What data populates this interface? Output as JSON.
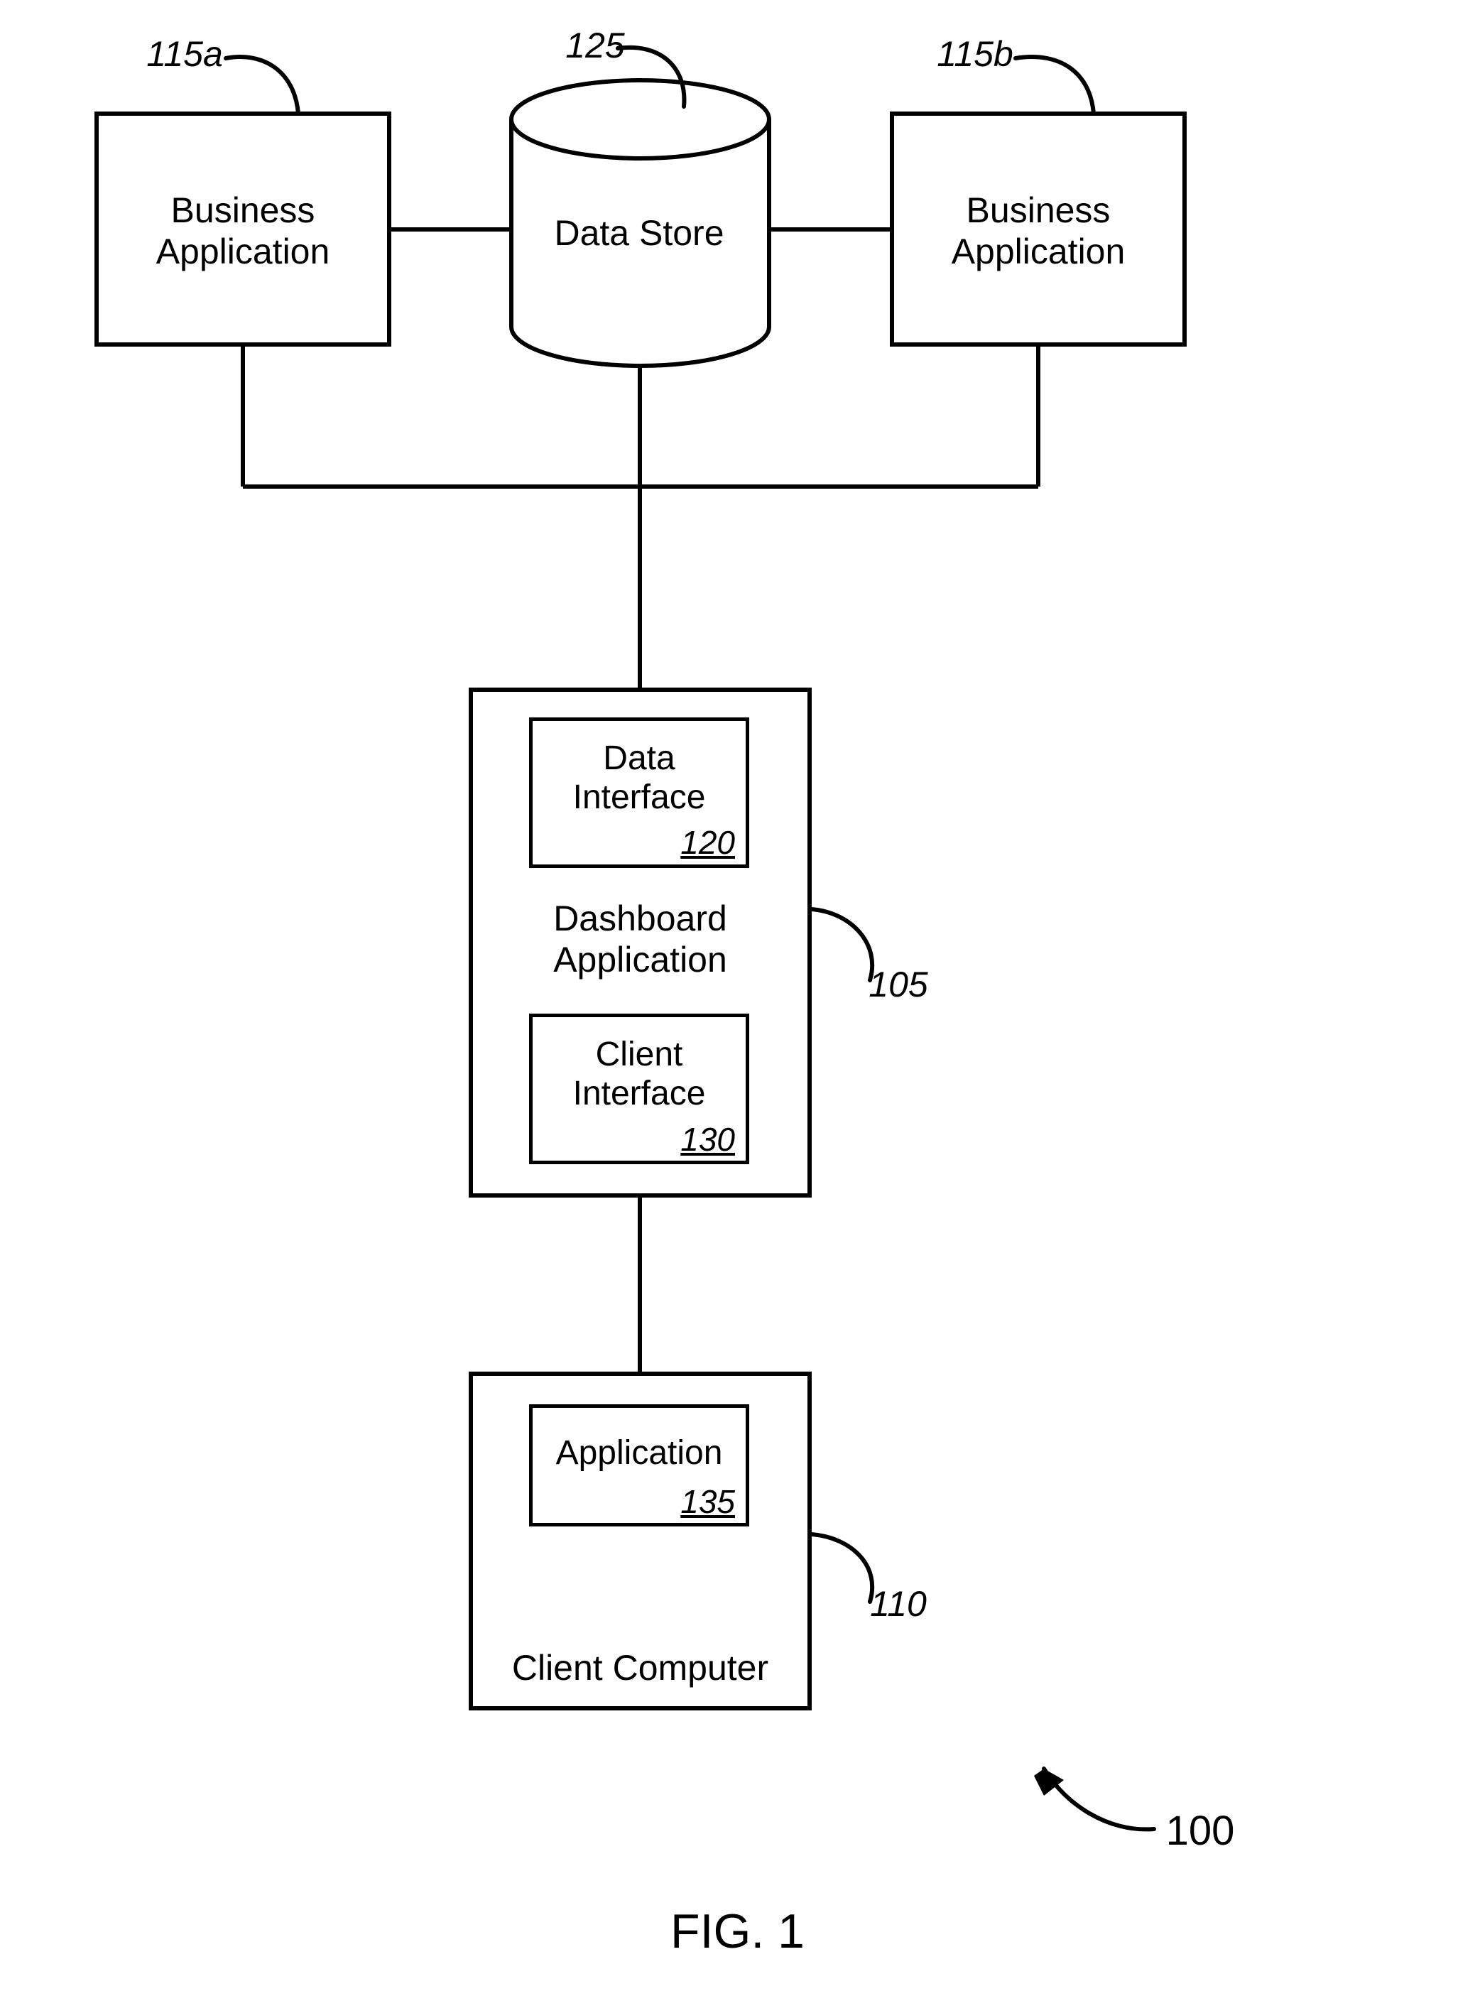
{
  "figure": {
    "title": "FIG. 1",
    "system_ref": "100"
  },
  "nodes": {
    "business_app_left": {
      "label": "Business\nApplication",
      "ref": "115a"
    },
    "business_app_right": {
      "label": "Business\nApplication",
      "ref": "115b"
    },
    "data_store": {
      "label": "Data Store",
      "ref": "125"
    },
    "dashboard": {
      "label": "Dashboard\nApplication",
      "ref": "105",
      "data_interface": {
        "label": "Data\nInterface",
        "ref": "120"
      },
      "client_interface": {
        "label": "Client\nInterface",
        "ref": "130"
      }
    },
    "client_computer": {
      "label": "Client Computer",
      "ref": "110",
      "application": {
        "label": "Application",
        "ref": "135"
      }
    }
  }
}
